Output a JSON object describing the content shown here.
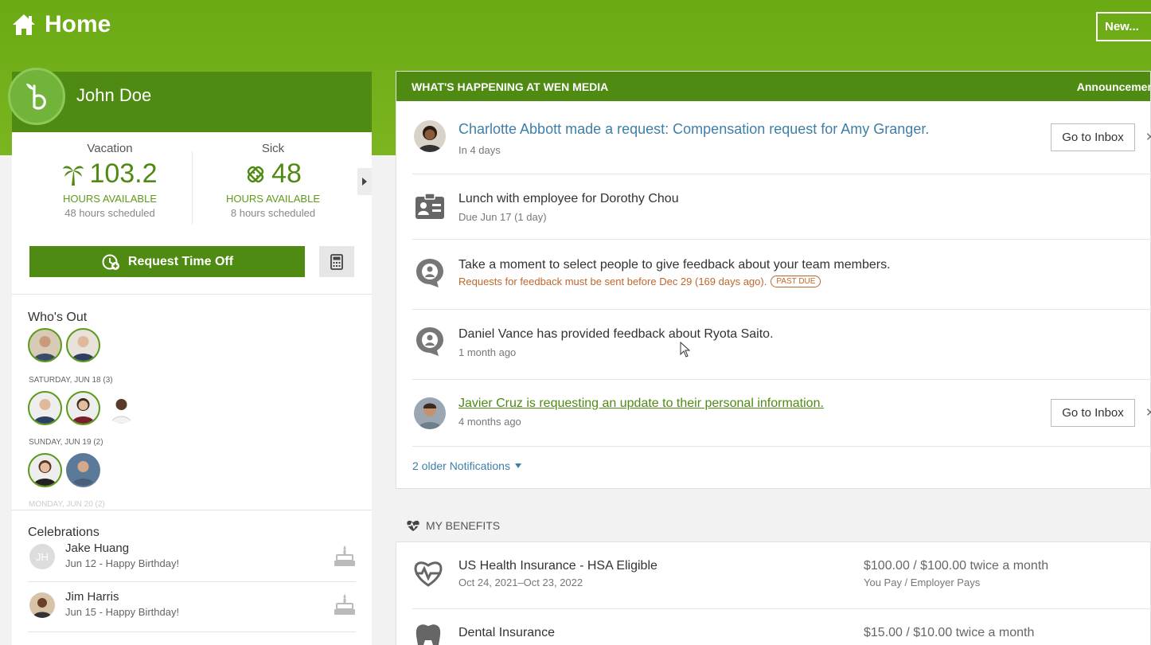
{
  "header": {
    "title": "Home",
    "new_label": "New..."
  },
  "profile": {
    "name": "John Doe"
  },
  "balances": [
    {
      "type": "Vacation",
      "value": "103.2",
      "available": "HOURS AVAILABLE",
      "scheduled": "48 hours scheduled",
      "icon": "palm-tree-icon"
    },
    {
      "type": "Sick",
      "value": "48",
      "available": "HOURS AVAILABLE",
      "scheduled": "8 hours scheduled",
      "icon": "bandage-icon"
    }
  ],
  "actions": {
    "request_time_off": "Request Time Off"
  },
  "whos_out": {
    "title": "Who's Out",
    "days": [
      {
        "label": "SATURDAY, JUN 18 (3)"
      },
      {
        "label": "SUNDAY, JUN 19 (2)"
      },
      {
        "label": "MONDAY, JUN 20 (2)"
      }
    ]
  },
  "celebrations": {
    "title": "Celebrations",
    "items": [
      {
        "initials": "JH",
        "name": "Jake Huang",
        "sub": "Jun 12 - Happy Birthday!"
      },
      {
        "initials": "",
        "name": "Jim Harris",
        "sub": "Jun 15 - Happy Birthday!"
      }
    ]
  },
  "feed": {
    "header": "WHAT'S HAPPENING AT WEN MEDIA",
    "header_right": "Announcemen",
    "items": [
      {
        "title": "Charlotte Abbott made a request: Compensation request for Amy Granger.",
        "sub": "In 4 days",
        "button": "Go to Inbox"
      },
      {
        "title": "Lunch with employee for Dorothy Chou",
        "sub": "Due Jun 17 (1 day)"
      },
      {
        "title": "Take a moment to select people to give feedback about your team members.",
        "sub": "Requests for feedback must be sent before Dec 29 (169 days ago).",
        "badge": "PAST DUE"
      },
      {
        "title": "Daniel Vance has provided feedback about Ryota Saito.",
        "sub": "1 month ago"
      },
      {
        "title": "Javier Cruz is requesting an update to their personal information.",
        "sub": "4 months ago",
        "button": "Go to Inbox"
      }
    ],
    "older": "2 older Notifications"
  },
  "benefits": {
    "title": "MY BENEFITS",
    "items": [
      {
        "name": "US Health Insurance - HSA Eligible",
        "dates": "Oct 24, 2021–Oct 23, 2022",
        "cost": "$100.00 / $100.00 twice a month",
        "who": "You Pay / Employer Pays"
      },
      {
        "name": "Dental Insurance",
        "dates": "",
        "cost": "$15.00 / $10.00 twice a month",
        "who": ""
      }
    ]
  },
  "colors": {
    "brand_green": "#4f8a12",
    "hero_green": "#72b01a",
    "link_blue": "#3e7fa8",
    "warn_orange": "#c0662a"
  }
}
